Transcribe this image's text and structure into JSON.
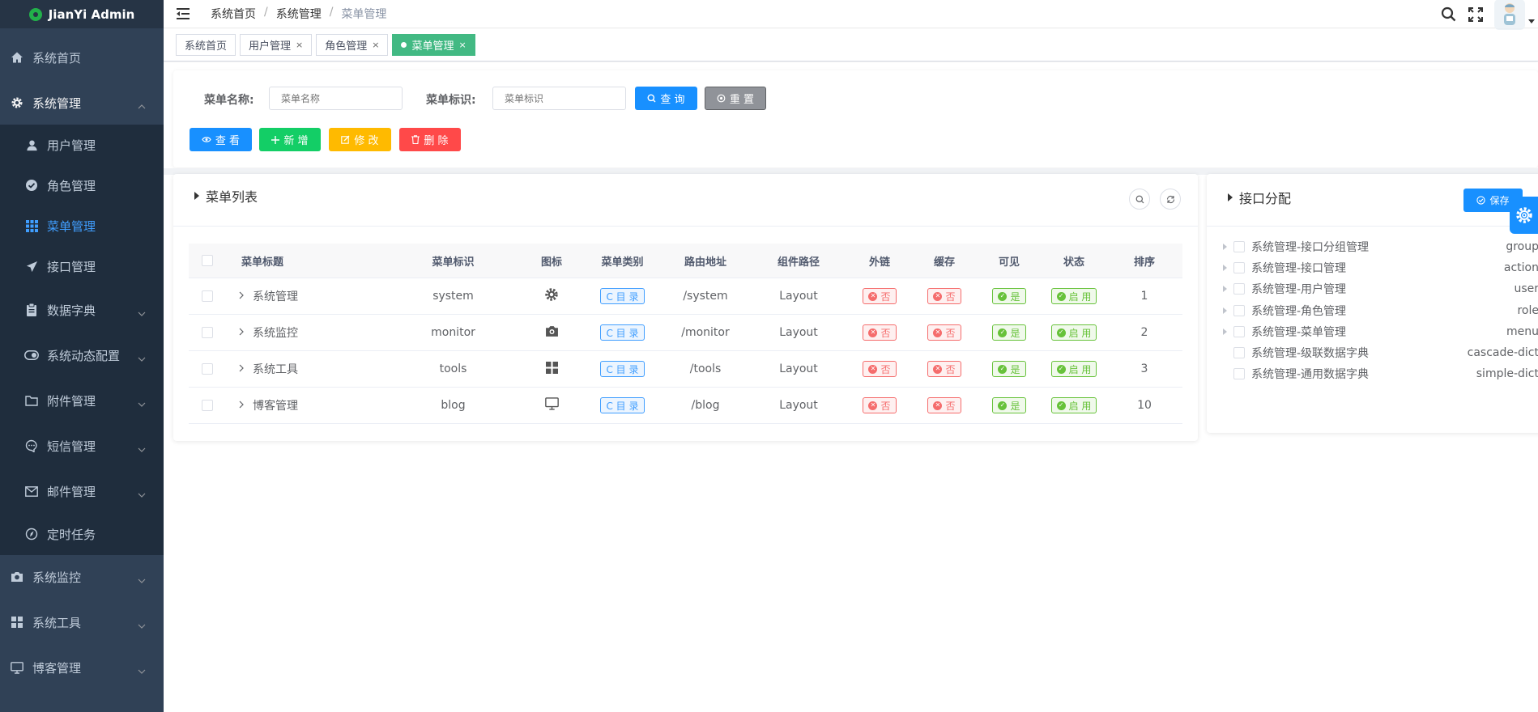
{
  "app": {
    "title": "JianYi Admin"
  },
  "sidebar": {
    "items": [
      {
        "label": "系统首页",
        "icon": "home-icon"
      },
      {
        "label": "系统管理",
        "icon": "gear-icon"
      },
      {
        "label": "用户管理",
        "icon": "user-icon"
      },
      {
        "label": "角色管理",
        "icon": "check-circle-icon"
      },
      {
        "label": "菜单管理",
        "icon": "grid-icon"
      },
      {
        "label": "接口管理",
        "icon": "send-icon"
      },
      {
        "label": "数据字典",
        "icon": "clipboard-icon"
      },
      {
        "label": "系统动态配置",
        "icon": "toggle-icon"
      },
      {
        "label": "附件管理",
        "icon": "folder-icon"
      },
      {
        "label": "短信管理",
        "icon": "message-icon"
      },
      {
        "label": "邮件管理",
        "icon": "mail-icon"
      },
      {
        "label": "定时任务",
        "icon": "compass-icon"
      },
      {
        "label": "系统监控",
        "icon": "camera-icon"
      },
      {
        "label": "系统工具",
        "icon": "grid-icon"
      },
      {
        "label": "博客管理",
        "icon": "monitor-icon"
      }
    ]
  },
  "header": {
    "breadcrumb": [
      "系统首页",
      "系统管理",
      "菜单管理"
    ],
    "separator": "/"
  },
  "tags": [
    {
      "label": "系统首页",
      "closable": false
    },
    {
      "label": "用户管理",
      "closable": true
    },
    {
      "label": "角色管理",
      "closable": true
    },
    {
      "label": "菜单管理",
      "closable": true,
      "active": true
    }
  ],
  "tag_close": "×",
  "search": {
    "name_label": "菜单名称:",
    "name_placeholder": "菜单名称",
    "key_label": "菜单标识:",
    "key_placeholder": "菜单标识",
    "query_label": "查 询",
    "reset_label": "重 置"
  },
  "actions": {
    "view": "查 看",
    "add": "新 增",
    "edit": "修 改",
    "delete": "删 除"
  },
  "menu_list": {
    "title": "菜单列表",
    "columns": [
      "菜单标题",
      "菜单标识",
      "图标",
      "菜单类别",
      "路由地址",
      "组件路径",
      "外链",
      "缓存",
      "可见",
      "状态",
      "排序"
    ],
    "rows": [
      {
        "title": "系统管理",
        "key": "system",
        "icon": "gear-icon",
        "type": "C 目 录",
        "path": "/system",
        "component": "Layout",
        "external": "否",
        "cache": "否",
        "visible": "是",
        "status": "启 用",
        "order": "1"
      },
      {
        "title": "系统监控",
        "key": "monitor",
        "icon": "camera-icon",
        "type": "C 目 录",
        "path": "/monitor",
        "component": "Layout",
        "external": "否",
        "cache": "否",
        "visible": "是",
        "status": "启 用",
        "order": "2"
      },
      {
        "title": "系统工具",
        "key": "tools",
        "icon": "grid-icon",
        "type": "C 目 录",
        "path": "/tools",
        "component": "Layout",
        "external": "否",
        "cache": "否",
        "visible": "是",
        "status": "启 用",
        "order": "3"
      },
      {
        "title": "博客管理",
        "key": "blog",
        "icon": "monitor-icon",
        "type": "C 目 录",
        "path": "/blog",
        "component": "Layout",
        "external": "否",
        "cache": "否",
        "visible": "是",
        "status": "启 用",
        "order": "10"
      }
    ]
  },
  "api_assign": {
    "title": "接口分配",
    "save_label": "保存",
    "items": [
      {
        "label": "系统管理-接口分组管理",
        "value": "group",
        "expandable": true
      },
      {
        "label": "系统管理-接口管理",
        "value": "action",
        "expandable": true
      },
      {
        "label": "系统管理-用户管理",
        "value": "user",
        "expandable": true
      },
      {
        "label": "系统管理-角色管理",
        "value": "role",
        "expandable": true
      },
      {
        "label": "系统管理-菜单管理",
        "value": "menu",
        "expandable": true
      },
      {
        "label": "系统管理-级联数据字典",
        "value": "cascade-dict",
        "expandable": false
      },
      {
        "label": "系统管理-通用数据字典",
        "value": "simple-dict",
        "expandable": false
      }
    ]
  },
  "colors": {
    "sidebar_bg": "#304156",
    "submenu_bg": "#1f2d3d",
    "accent": "#409eff",
    "tag_active": "#42b983",
    "primary_btn": "#1890ff",
    "danger": "#ff4949",
    "warning": "#ffba00",
    "success": "#13ce66"
  }
}
